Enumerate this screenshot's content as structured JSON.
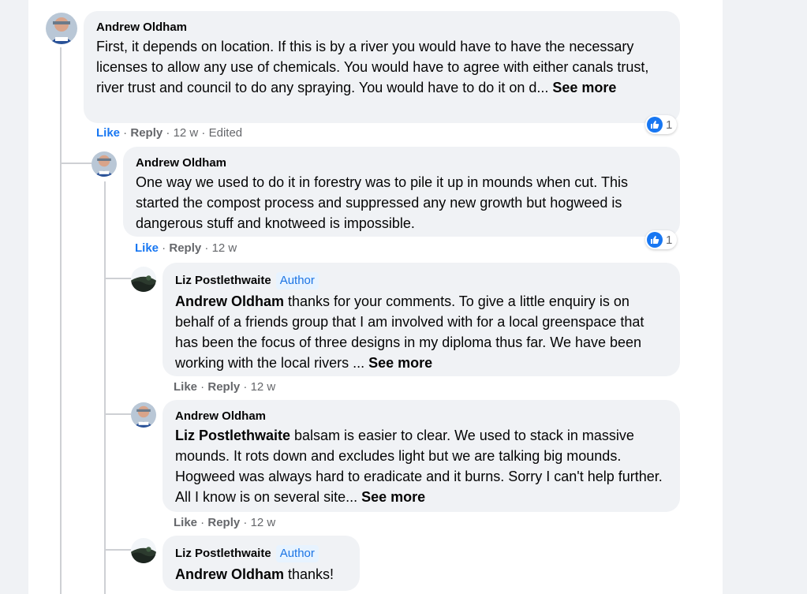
{
  "comments": [
    {
      "author": "Andrew Oldham",
      "text": "First, it depends on location. If this is by a river you would have to have the necessary licenses to allow any use of chemicals. You would have to agree with either canals trust, river trust and council to do any spraying. You would have to do it on d... ",
      "see_more": "See more",
      "like": "Like",
      "reply": "Reply",
      "time": "12 w",
      "edited": "Edited",
      "reactions": "1"
    },
    {
      "author": "Andrew Oldham",
      "text": "One way we used to do it in forestry was to pile it up in mounds when cut. This started the compost process and suppressed any new growth but hogweed is dangerous stuff and knotweed is impossible.",
      "like": "Like",
      "reply": "Reply",
      "time": "12 w",
      "reactions": "1"
    },
    {
      "author": "Liz Postlethwaite",
      "badge": "Author",
      "mention": "Andrew Oldham",
      "text": " thanks for your comments. To give a little enquiry is on behalf of a friends group that I am involved with for a local greenspace that has been the focus of three designs in my diploma thus far. We have been working with the local rivers ... ",
      "see_more": "See more",
      "like": "Like",
      "reply": "Reply",
      "time": "12 w"
    },
    {
      "author": "Andrew Oldham",
      "mention": "Liz Postlethwaite",
      "text": " balsam is easier to clear. We used to stack in massive mounds. It rots down and excludes light but we are talking big mounds. Hogweed was always hard to eradicate and it burns. Sorry I can't help further. All I know is on several site... ",
      "see_more": "See more",
      "like": "Like",
      "reply": "Reply",
      "time": "12 w"
    },
    {
      "author": "Liz Postlethwaite",
      "badge": "Author",
      "mention": "Andrew Oldham",
      "text": " thanks!"
    }
  ],
  "separator": " · ",
  "colors": {
    "like_blue": "#1877f2",
    "bubble": "#f0f2f5",
    "badge_bg": "#e7f3ff",
    "badge_text": "#1b74e4",
    "secondary_text": "#65676b"
  },
  "icons": {
    "reaction": "like-thumb-icon",
    "avatar_andrew": "andrew-oldham-avatar",
    "avatar_liz": "liz-postlethwaite-avatar"
  }
}
